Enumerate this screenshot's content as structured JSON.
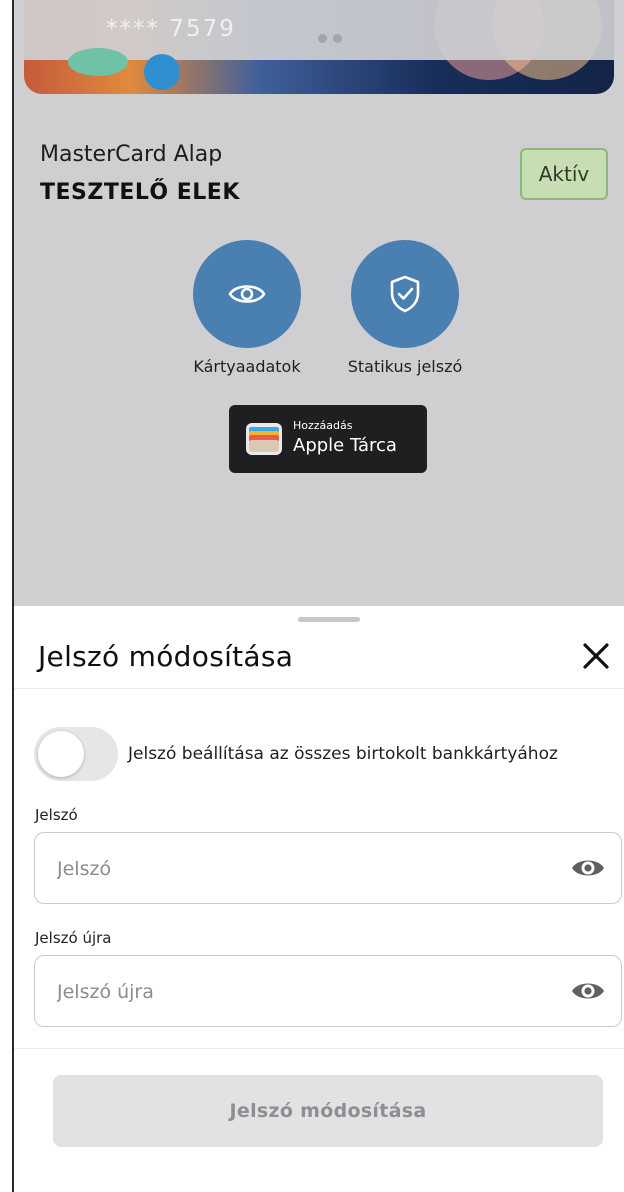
{
  "card": {
    "masked_number": "**** 7579",
    "product_name": "MasterCard Alap",
    "holder_name": "TESZTELŐ ELEK",
    "status": "Aktív"
  },
  "actions": [
    {
      "label": "Kártyaadatok",
      "icon": "eye-icon"
    },
    {
      "label": "Statikus jelszó",
      "icon": "shield-check-icon"
    }
  ],
  "wallet": {
    "small_label": "Hozzáadás",
    "big_label": "Apple Tárca"
  },
  "sheet": {
    "title": "Jelszó módosítása",
    "toggle_label": "Jelszó beállítása az összes birtokolt bankkártyához",
    "toggle_on": false,
    "password": {
      "label": "Jelszó",
      "placeholder": "Jelszó",
      "value": ""
    },
    "password_again": {
      "label": "Jelszó újra",
      "placeholder": "Jelszó újra",
      "value": ""
    },
    "submit_label": "Jelszó módosítása"
  },
  "colors": {
    "action_blue": "#4a7fb1",
    "status_green": "#c7deb5",
    "overlay_gray": "#cfcfd2"
  }
}
